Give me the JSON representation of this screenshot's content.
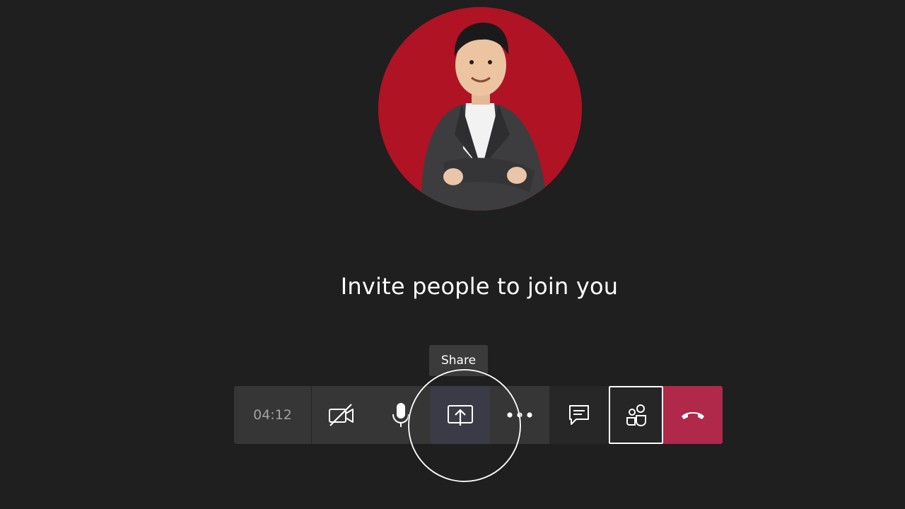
{
  "meeting": {
    "invite_message": "Invite people to join you",
    "timer": "04:12"
  },
  "tooltip": {
    "label": "Share"
  },
  "toolbar": {
    "buttons": [
      {
        "name": "camera-off",
        "icon": "video-off-icon"
      },
      {
        "name": "microphone",
        "icon": "microphone-icon"
      },
      {
        "name": "share",
        "icon": "share-screen-icon"
      },
      {
        "name": "more-actions",
        "icon": "ellipsis-icon"
      },
      {
        "name": "chat",
        "icon": "chat-icon"
      },
      {
        "name": "participants",
        "icon": "people-icon"
      },
      {
        "name": "hang-up",
        "icon": "phone-hangup-icon"
      }
    ]
  },
  "colors": {
    "background": "#1f1f1f",
    "toolbar": "#363636",
    "hangup": "#b0294a",
    "avatar_background": "#b01324"
  }
}
